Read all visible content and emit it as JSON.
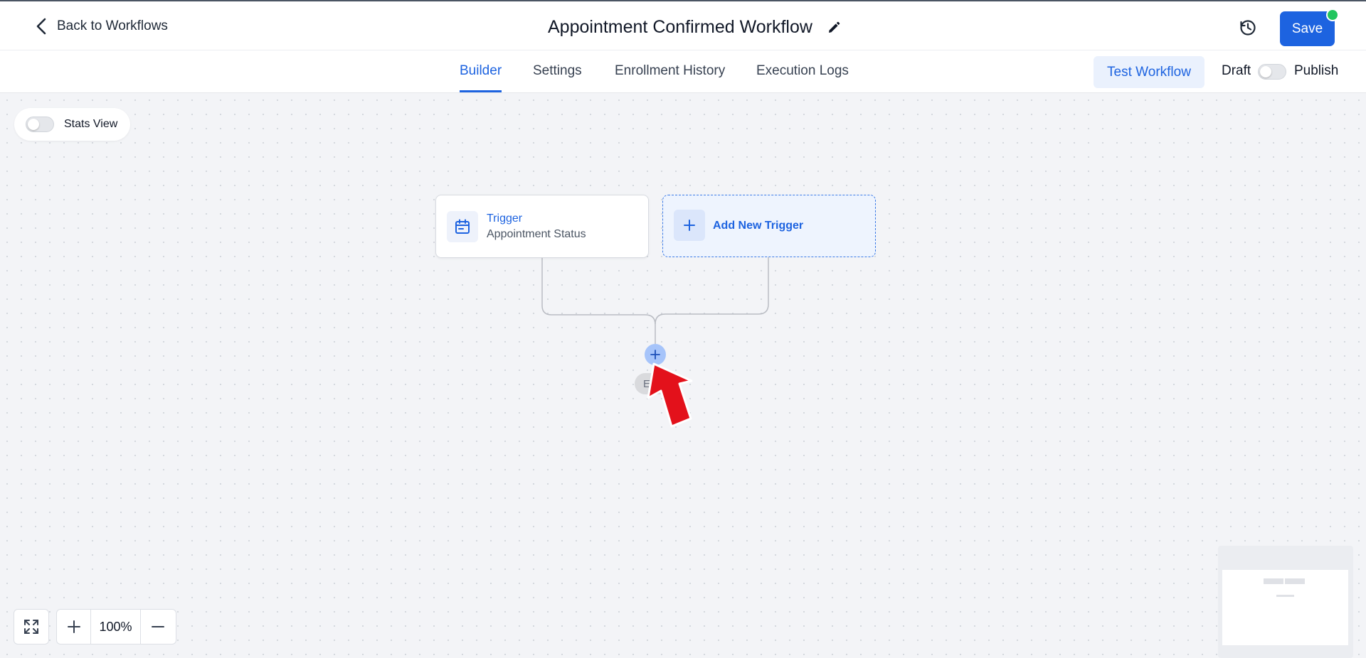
{
  "header": {
    "back_label": "Back to Workflows",
    "title": "Appointment Confirmed Workflow",
    "save_label": "Save"
  },
  "tabs": [
    {
      "label": "Builder",
      "active": true
    },
    {
      "label": "Settings",
      "active": false
    },
    {
      "label": "Enrollment History",
      "active": false
    },
    {
      "label": "Execution Logs",
      "active": false
    }
  ],
  "actions": {
    "test_label": "Test Workflow",
    "draft_label": "Draft",
    "publish_label": "Publish",
    "published": false
  },
  "stats_view": {
    "label": "Stats View",
    "enabled": false
  },
  "canvas": {
    "trigger": {
      "title": "Trigger",
      "subtitle": "Appointment Status",
      "icon": "calendar-icon"
    },
    "add_trigger_label": "Add New Trigger",
    "end_label": "E"
  },
  "zoom": {
    "level": "100%"
  },
  "colors": {
    "accent": "#1d63e0",
    "status_dot": "#22c55e",
    "pointer": "#e3111b"
  }
}
